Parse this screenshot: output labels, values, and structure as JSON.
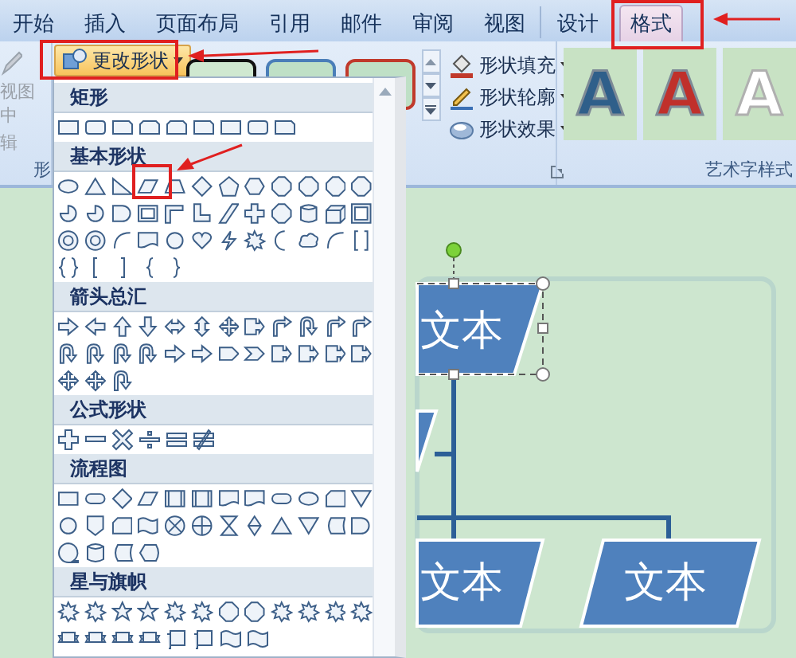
{
  "tabs": [
    {
      "label": "开始",
      "selected": false
    },
    {
      "label": "插入",
      "selected": false
    },
    {
      "label": "页面布局",
      "selected": false
    },
    {
      "label": "引用",
      "selected": false
    },
    {
      "label": "邮件",
      "selected": false
    },
    {
      "label": "审阅",
      "selected": false
    },
    {
      "label": "视图",
      "selected": false
    },
    {
      "label": "设计",
      "selected": false
    },
    {
      "label": "格式",
      "selected": true
    }
  ],
  "ribbon": {
    "left_group": {
      "lines": [
        "视图中",
        "辑"
      ],
      "label": "形"
    },
    "change_shape_button": {
      "label": "更改形状"
    },
    "shape_commands": [
      {
        "label": "形状填充"
      },
      {
        "label": "形状轮廓"
      },
      {
        "label": "形状效果"
      }
    ],
    "wordart_group": {
      "label": "艺术字样式",
      "samples": [
        {
          "text": "A",
          "color": "#2f5f8a"
        },
        {
          "text": "A",
          "color": "#c0302b"
        },
        {
          "text": "A",
          "color": "#ffffff"
        }
      ]
    }
  },
  "shape_menu": {
    "sections": [
      {
        "title": "矩形"
      },
      {
        "title": "基本形状"
      },
      {
        "title": "箭头总汇"
      },
      {
        "title": "公式形状"
      },
      {
        "title": "流程图"
      },
      {
        "title": "星与旗帜"
      }
    ]
  },
  "diagram": {
    "boxes": [
      {
        "text": "文本"
      },
      {
        "text": "文本"
      },
      {
        "text": "文本"
      }
    ]
  }
}
